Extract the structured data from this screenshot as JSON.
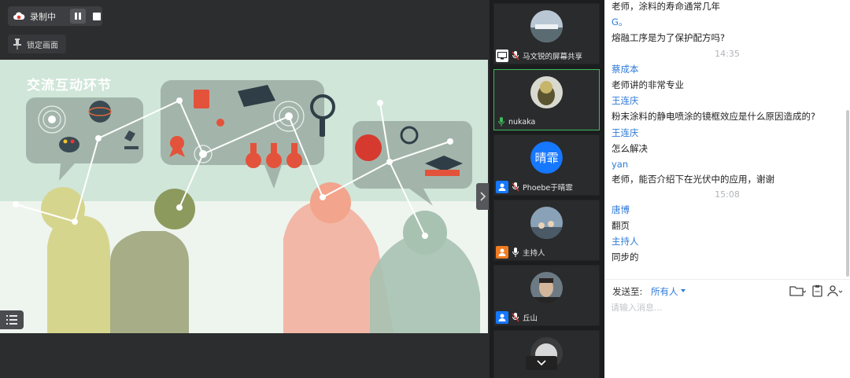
{
  "recording": {
    "status_label": "录制中"
  },
  "lock_screen": {
    "label": "锁定画面"
  },
  "slide": {
    "title": "交流互动环节"
  },
  "participants": [
    {
      "name": "马文锐的屏幕共享",
      "kind": "screen",
      "avatar_type": "photo-landscape"
    },
    {
      "name": "nukaka",
      "kind": "mic-on",
      "avatar_type": "photo-character"
    },
    {
      "name": "Phoebe于晴霏",
      "kind": "user-muted",
      "avatar_text": "晴霏"
    },
    {
      "name": "主持人",
      "kind": "host",
      "avatar_type": "photo-group"
    },
    {
      "name": "丘山",
      "kind": "user-muted",
      "avatar_type": "photo-portrait"
    }
  ],
  "chat": {
    "messages": [
      {
        "type": "text",
        "content": "老师，涂料的寿命通常几年"
      },
      {
        "type": "sender",
        "content": "G。"
      },
      {
        "type": "text",
        "content": "熔融工序是为了保护配方吗?"
      },
      {
        "type": "time",
        "content": "14:35"
      },
      {
        "type": "sender",
        "content": "蔡成本"
      },
      {
        "type": "text",
        "content": "老师讲的非常专业"
      },
      {
        "type": "sender",
        "content": "王连庆"
      },
      {
        "type": "text",
        "content": "粉末涂料的静电喷涂的镜框效应是什么原因造成的?"
      },
      {
        "type": "sender",
        "content": "王连庆"
      },
      {
        "type": "text",
        "content": "怎么解决"
      },
      {
        "type": "sender",
        "content": "yan"
      },
      {
        "type": "text",
        "content": "老师，能否介绍下在光伏中的应用，谢谢"
      },
      {
        "type": "time",
        "content": "15:08"
      },
      {
        "type": "sender",
        "content": "唐博"
      },
      {
        "type": "text",
        "content": "翻页"
      },
      {
        "type": "sender",
        "content": "主持人"
      },
      {
        "type": "text",
        "content": "同步的"
      }
    ],
    "send_to_label": "发送至:",
    "send_to_value": "所有人",
    "input_placeholder": "请输入消息..."
  },
  "colors": {
    "accent": "#2f7ad8",
    "active_speaker": "#3dba5a",
    "badge_blue": "#1677ff",
    "host_orange": "#f07c22"
  }
}
